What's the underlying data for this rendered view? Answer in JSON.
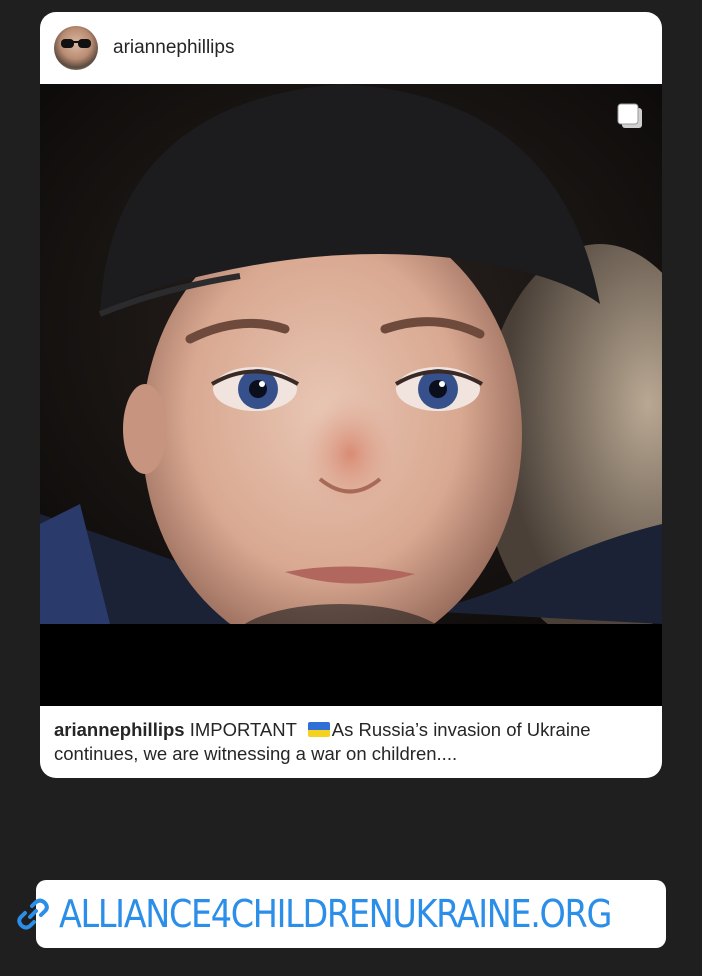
{
  "post": {
    "username": "ariannephillips",
    "caption_user": "ariannephillips",
    "caption_part1": "IMPORTANT",
    "caption_flag_icon": "ukraine-flag-icon",
    "caption_part2": "As Russia’s invasion of Ukraine continues, we are witnessing a war on children....",
    "multi_photo_icon": "carousel-icon"
  },
  "link_sticker": {
    "icon": "link-icon",
    "label": "ALLIANCE4CHILDRENUKRAINE.ORG",
    "color": "#2b8ee8"
  },
  "colors": {
    "background": "#1f1f1f",
    "card": "#ffffff",
    "text": "#262626"
  }
}
